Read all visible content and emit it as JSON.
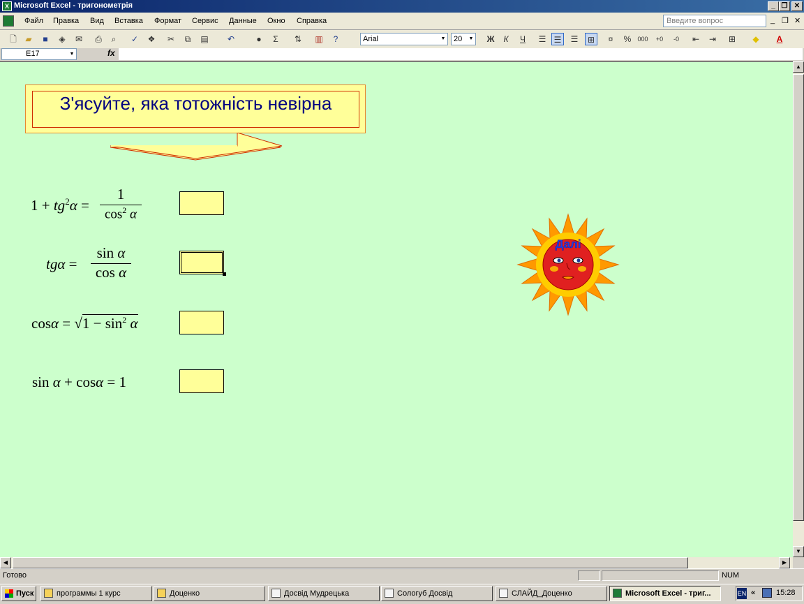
{
  "window": {
    "title": "Microsoft Excel - тригонометрія"
  },
  "menu": {
    "items": [
      "Файл",
      "Правка",
      "Вид",
      "Вставка",
      "Формат",
      "Сервис",
      "Данные",
      "Окно",
      "Справка"
    ],
    "ask_placeholder": "Введите вопрос"
  },
  "toolbar": {
    "font": "Arial",
    "font_size": "20"
  },
  "formula_bar": {
    "cell_ref": "E17",
    "fx": "fx",
    "value": ""
  },
  "sheet": {
    "background": "#ccffcc",
    "banner": "З'ясуйте, яка тотожність невірна",
    "next_button": "Далі"
  },
  "status": {
    "text": "Готово",
    "num": "NUM"
  },
  "taskbar": {
    "start": "Пуск",
    "tasks": [
      "программы 1 курс",
      "Доценко",
      "Досвід Мудрецька",
      "Сологуб Досвід",
      "СЛАЙД_Доценко",
      "Microsoft Excel - триг..."
    ],
    "lang": "EN",
    "clock": "15:28"
  }
}
